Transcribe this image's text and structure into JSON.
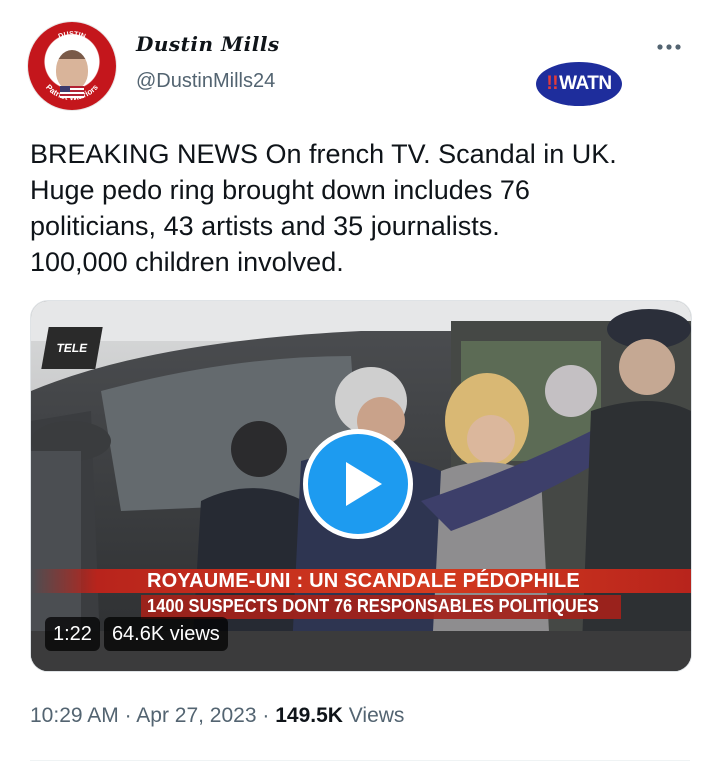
{
  "author": {
    "display_name": "Dustin Mills",
    "handle": "@DustinMills24",
    "avatar_text_top": "DUSTIN",
    "avatar_text_left": "Patriot",
    "avatar_text_left2": "Warriors",
    "avatar_text_right": "Patriot Warriors"
  },
  "badge": {
    "prefix": "!!",
    "label": "WATN"
  },
  "more_icon": "more-horizontal-icon",
  "tweet": {
    "text_line_1": "BREAKING NEWS On french TV. Scandal in UK.",
    "text_line_2": "Huge pedo ring brought down includes 76",
    "text_line_3": "politicians, 43 artists and 35 journalists.",
    "text_line_4": "100,000 children involved."
  },
  "video": {
    "channel_logo": "TELE",
    "banner_headline": "ROYAUME-UNI : UN SCANDALE PÉDOPHILE",
    "banner_subline": "1400 SUSPECTS DONT 76 RESPONSABLES POLITIQUES",
    "duration": "1:22",
    "views": "64.6K views",
    "play_icon": "play-icon"
  },
  "meta": {
    "time": "10:29 AM",
    "separator": "·",
    "date": "Apr 27, 2023",
    "views_count": "149.5K",
    "views_label": "Views"
  },
  "colors": {
    "accent": "#1d9bf0",
    "banner_red": "#c62d1f",
    "badge_blue": "#1e2d9c",
    "secondary_text": "#536471"
  }
}
